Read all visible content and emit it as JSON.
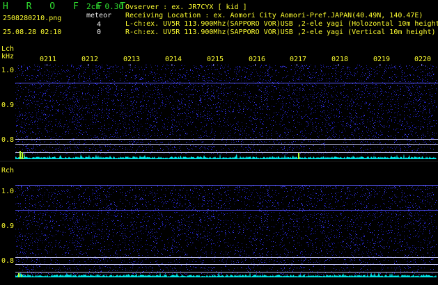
{
  "header": {
    "app_title": "H R O F F T",
    "filename": "2508280210.png",
    "datetime": "25.08.28 02:10",
    "mode": "2ch 0.30",
    "meteor_label": "meteor",
    "meteor_lch": "4",
    "meteor_rch": "0",
    "observer": "Ovserver              : ex. JR7CYX [ kid ]",
    "location": "Receiving Location : ex. Aomori City Aomori-Pref.JAPAN(40.49N, 140.47E)",
    "lch_info": "L-ch:ex. UV5R 113.900Mhz(SAPPORO VOR)USB ,2-ele yagi (Holozontal 10m height)",
    "rch_info": "R-ch:ex. UV5R 113.900Mhz(SAPPORO VOR)USB ,2-ele yagi (Vertical 10m height)"
  },
  "time_ticks": [
    "0211",
    "0212",
    "0213",
    "0214",
    "0215",
    "0216",
    "0217",
    "0218",
    "0219",
    "0220"
  ],
  "lch_panel": {
    "label": "Lch",
    "unit": "kHz",
    "freq_labels": [
      "1.0",
      "0.9",
      "0.8"
    ]
  },
  "rch_panel": {
    "label": "Rch",
    "freq_labels": [
      "1.0",
      "0.9",
      "0.8"
    ]
  },
  "colors": {
    "background": "#000000",
    "noise": "#1c1caa",
    "signal_line": "#5a5aff",
    "grid_line": "#bfbfe8",
    "label": "#ffff30",
    "header_text": "#30e030",
    "level_trace": "#00e8e8",
    "meteor_flash": "#b8ff30"
  }
}
